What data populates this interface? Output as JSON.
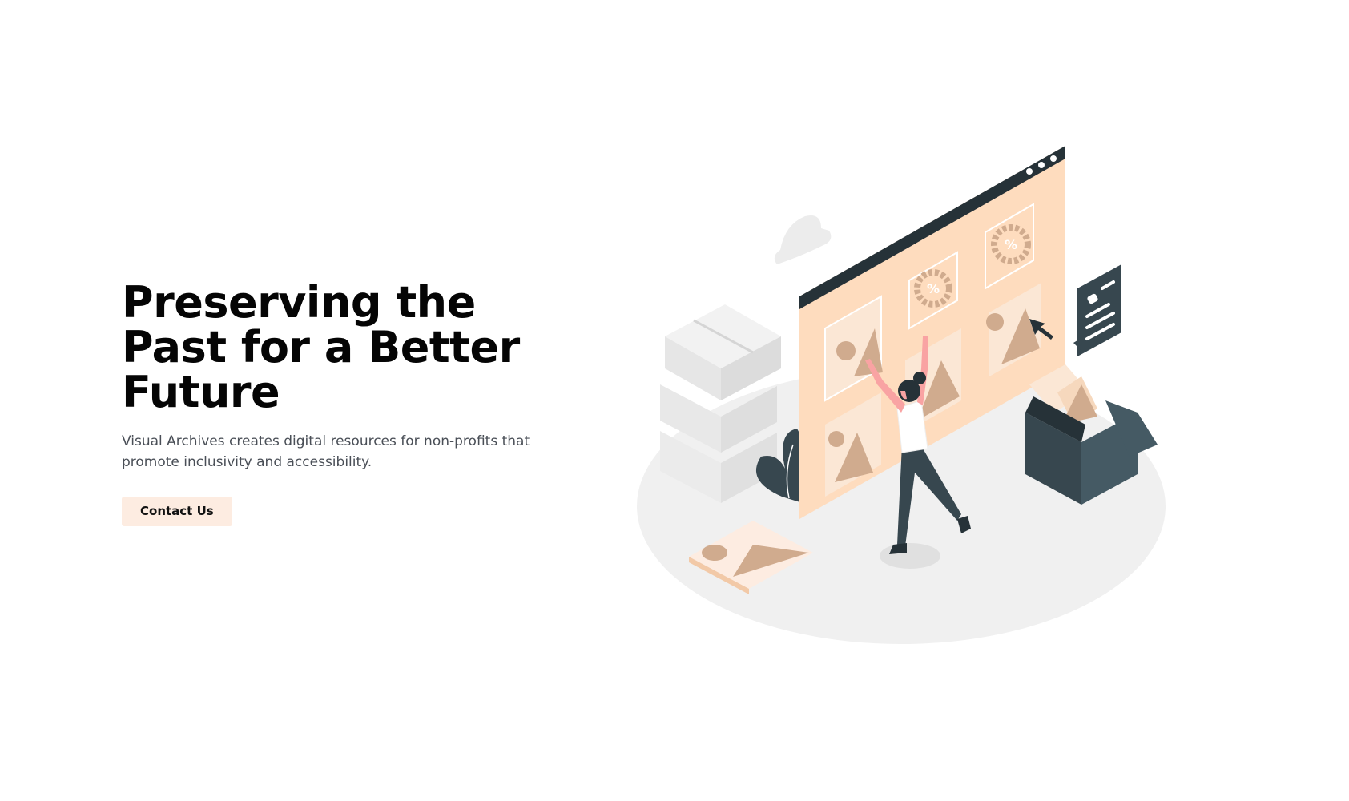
{
  "hero": {
    "title_lines": [
      "Preserving the",
      "Past for a Better",
      "Future"
    ],
    "subtitle_lines": [
      "Visual Archives creates digital resources for non-profits that",
      "promote inclusivity and accessibility."
    ],
    "cta_label": "Contact Us"
  },
  "illustration": {
    "screen_badge_1": "%",
    "screen_badge_2": "%"
  },
  "colors": {
    "title": "#050505",
    "subtitle": "#4a4f57",
    "cta_bg": "#fdece1",
    "peach": "#fedcbe",
    "tan": "#d0ab8e",
    "dark": "#263238",
    "floor": "#f0f0f0"
  }
}
